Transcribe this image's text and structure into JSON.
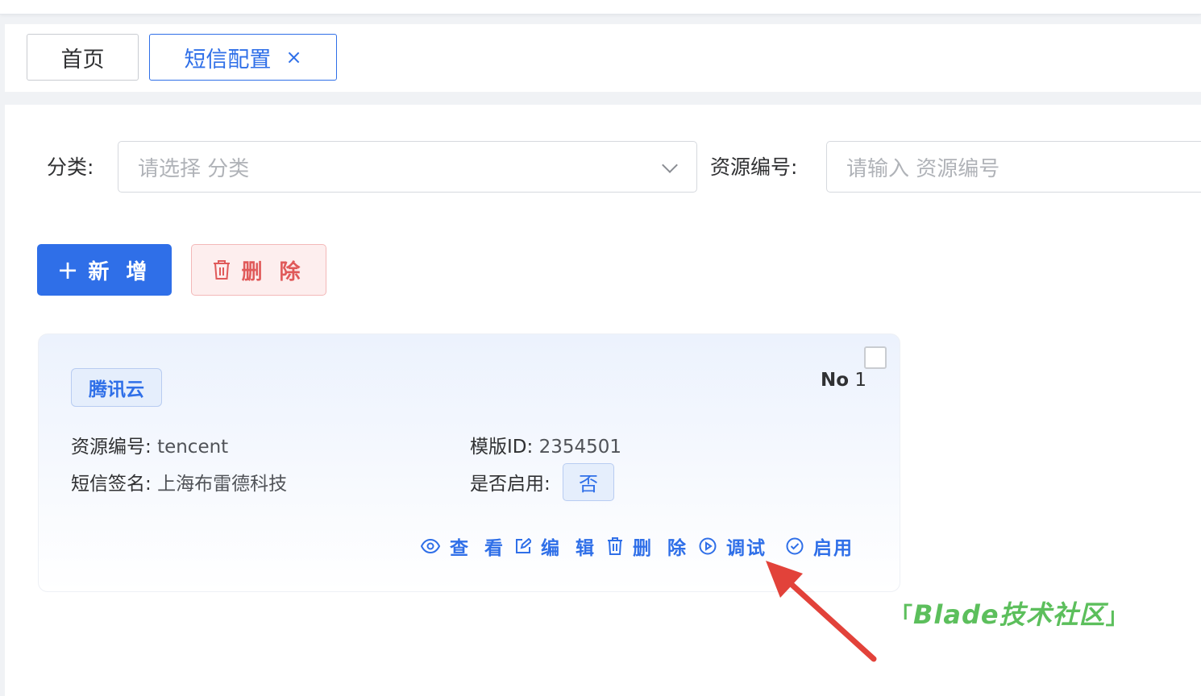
{
  "tabs": [
    {
      "label": "首页"
    },
    {
      "label": "短信配置",
      "close": "×"
    }
  ],
  "search": {
    "category_label": "分类:",
    "category_placeholder": "请选择 分类",
    "resource_label": "资源编号:",
    "resource_placeholder": "请输入 资源编号"
  },
  "toolbar": {
    "add_label": "新 增",
    "add_icon": "+",
    "delete_label": "删 除"
  },
  "card": {
    "provider": "腾讯云",
    "no_label": "No",
    "no_value": "1",
    "resource_label": "资源编号:",
    "resource_value": "tencent",
    "template_label": "模版ID:",
    "template_value": "2354501",
    "sign_label": "短信签名:",
    "sign_value": "上海布雷德科技",
    "enabled_label": "是否启用:",
    "enabled_value": "否",
    "actions": [
      {
        "label": "查 看",
        "icon": "eye-icon"
      },
      {
        "label": "编 辑",
        "icon": "edit-icon"
      },
      {
        "label": "删 除",
        "icon": "trash-icon"
      },
      {
        "label": "调试",
        "icon": "play-circle-icon"
      },
      {
        "label": "启用",
        "icon": "check-circle-icon"
      }
    ]
  },
  "watermark": {
    "text": "Blade技术社区",
    "left_bracket": "「",
    "right_bracket": "」"
  },
  "colors": {
    "primary": "#2f6fe8",
    "danger": "#e05a5a",
    "arrow": "#e2423a",
    "watermark": "#5cbf5c"
  }
}
